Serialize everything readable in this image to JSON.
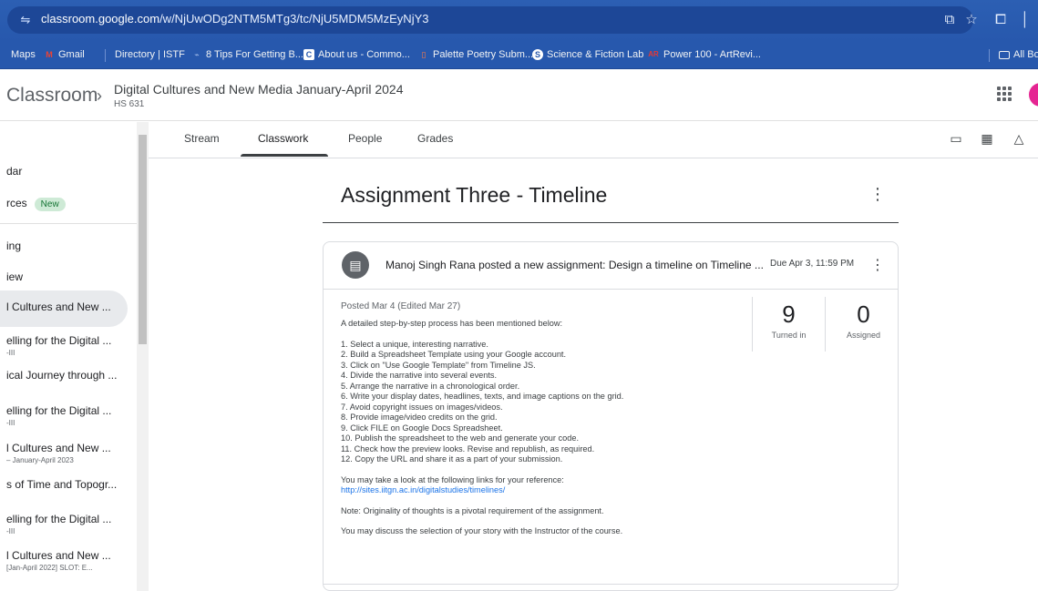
{
  "browser": {
    "url_host": "classroom.google.com",
    "url_path": "/w/NjUwODg2NTM5MTg3/tc/NjU5MDM5MzEyNjY3",
    "bookmarks": [
      {
        "label": "Maps",
        "icon": "maps-icon"
      },
      {
        "label": "Gmail",
        "icon": "gmail-icon"
      },
      {
        "label": "Directory | ISTF",
        "icon": "istf-icon"
      },
      {
        "label": "8 Tips For Getting B...",
        "icon": "tips-icon"
      },
      {
        "label": "About us - Commo...",
        "icon": "commons-icon"
      },
      {
        "label": "Palette Poetry Subm...",
        "icon": "palette-icon"
      },
      {
        "label": "Science & Fiction Lab",
        "icon": "lab-icon"
      },
      {
        "label": "Power 100 - ArtRevi...",
        "icon": "artreview-icon"
      }
    ],
    "all_bookmarks": "All Bo"
  },
  "header": {
    "brand": "Classroom",
    "course_title": "Digital Cultures and New Media January-April 2024",
    "course_section": "HS 631"
  },
  "sidebar": {
    "items": [
      {
        "label": "dar",
        "sub": ""
      },
      {
        "label": "rces",
        "sub": "",
        "badge": "New"
      },
      {
        "label": "ing",
        "sub": ""
      },
      {
        "label": "iew",
        "sub": ""
      },
      {
        "label": "l Cultures and New ...",
        "sub": ""
      },
      {
        "label": "elling for the Digital ...",
        "sub": "-III"
      },
      {
        "label": "ical Journey through ...",
        "sub": ""
      },
      {
        "label": "elling for the Digital ...",
        "sub": "-III"
      },
      {
        "label": "l Cultures and New ...",
        "sub": "– January-April 2023"
      },
      {
        "label": "s of Time and Topogr...",
        "sub": ""
      },
      {
        "label": "elling for the Digital ...",
        "sub": "-III"
      },
      {
        "label": "l Cultures and New ...",
        "sub": "[Jan-April 2022] SLOT: E..."
      }
    ]
  },
  "tabs": [
    {
      "label": "Stream"
    },
    {
      "label": "Classwork"
    },
    {
      "label": "People"
    },
    {
      "label": "Grades"
    }
  ],
  "assignment": {
    "title": "Assignment Three - Timeline",
    "headline": "Manoj Singh Rana posted a new assignment: Design a timeline on Timeline ...",
    "due": "Due Apr 3, 11:59 PM",
    "posted": "Posted Mar 4 (Edited Mar 27)",
    "intro": "A detailed step-by-step process has been mentioned below:",
    "steps": [
      "1. Select a unique, interesting narrative.",
      "2. Build a Spreadsheet Template using your Google account.",
      "3. Click on \"Use Google Template\" from Timeline JS.",
      "4. Divide the narrative into several events.",
      "5. Arrange the narrative in a chronological order.",
      "6. Write your display dates, headlines, texts, and image captions on the grid.",
      "7. Avoid copyright issues on images/videos.",
      "8. Provide image/video credits on the grid.",
      "9. Click FILE on Google Docs Spreadsheet.",
      "10. Publish the spreadsheet to the web and generate your code.",
      "11. Check how the preview looks. Revise and republish, as required.",
      "12. Copy the URL and share it as a part of your submission."
    ],
    "reference_text": "You may take a look at the following links for your reference:",
    "reference_link": "http://sites.iitgn.ac.in/digitalstudies/timelines/",
    "note": "Note: Originality of thoughts is a pivotal requirement of the assignment.",
    "discuss": "You may discuss the selection of your story with the Instructor of the course.",
    "turned_in": "9",
    "turned_in_label": "Turned in",
    "assigned": "0",
    "assigned_label": "Assigned"
  }
}
